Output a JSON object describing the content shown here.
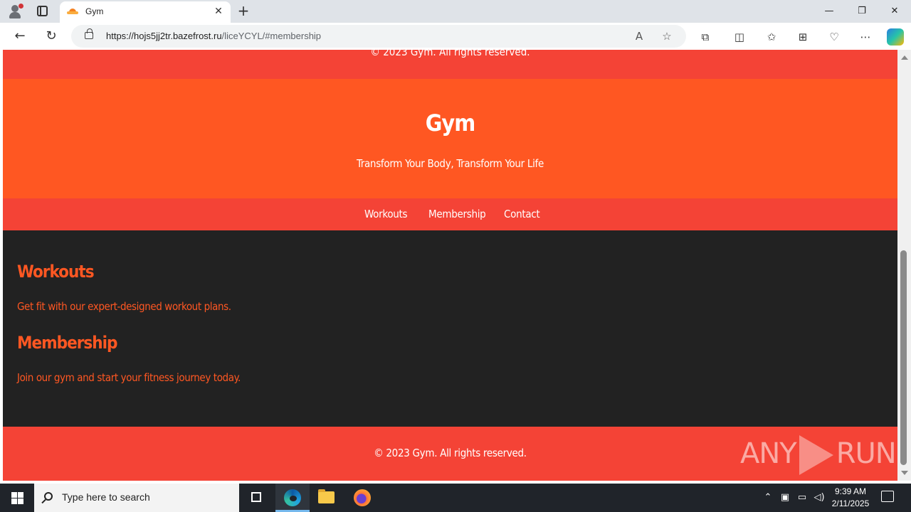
{
  "browser": {
    "tab_title": "Gym",
    "url_host": "https://hojs5jj2tr.bazefrost.ru",
    "url_path": "/liceYCYL/#membership",
    "icons": [
      "profile-icon",
      "tab-actions-icon",
      "tab-favicon",
      "close-icon",
      "plus-icon",
      "back-icon",
      "refresh-icon",
      "lock-icon",
      "read-aloud-icon",
      "favorite-star-icon",
      "extensions-icon",
      "split-screen-icon",
      "favorites-icon",
      "collections-icon",
      "browser-essentials-icon",
      "more-icon",
      "copilot-icon"
    ]
  },
  "page": {
    "prev_footer": "© 2023 Gym. All rights reserved.",
    "header": {
      "title": "Gym",
      "tagline": "Transform Your Body, Transform Your Life"
    },
    "nav": [
      "Workouts",
      "Membership",
      "Contact"
    ],
    "sections": [
      {
        "title": "Workouts",
        "text": "Get fit with our expert-designed workout plans."
      },
      {
        "title": "Membership",
        "text": "Join our gym and start your fitness journey today."
      }
    ],
    "footer": "© 2023 Gym. All rights reserved.",
    "watermark": [
      "ANY",
      "RUN"
    ],
    "colors": {
      "header": "#ff5722",
      "nav": "#f44336",
      "main": "#222222",
      "accent": "#ff5722"
    }
  },
  "taskbar": {
    "search_placeholder": "Type here to search",
    "time": "9:39 AM",
    "date": "2/11/2025"
  }
}
